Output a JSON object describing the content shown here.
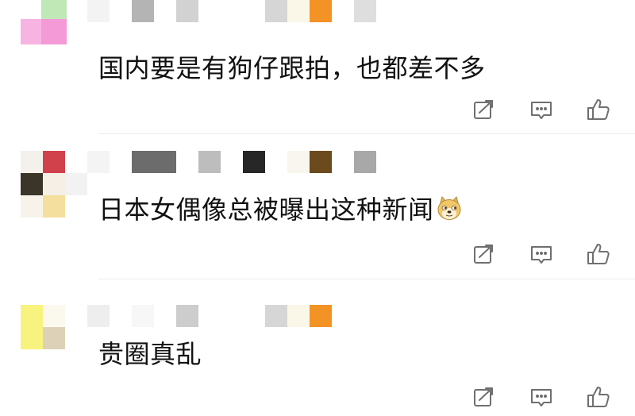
{
  "comments": [
    {
      "text": "国内要是有狗仔跟拍，也都差不多",
      "emoji": ""
    },
    {
      "text": "日本女偶像总被曝出这种新闻",
      "emoji": "doge-emoji"
    },
    {
      "text": "贵圈真乱",
      "emoji": ""
    }
  ],
  "actions": {
    "repost_icon": "repost-icon",
    "comment_icon": "comment-icon",
    "like_icon": "thumbs-up-icon"
  },
  "colors": {
    "text": "#111111",
    "icon": "#6f6f6f",
    "divider": "#ececec",
    "avatar_pink": "#f5a6dc",
    "avatar_green": "#a8e0a0",
    "avatar_red": "#d0404a",
    "avatar_dark": "#3a3528",
    "avatar_yellow": "#f8f09a",
    "name_orange": "#f39325",
    "name_brown": "#6b4a1e"
  }
}
